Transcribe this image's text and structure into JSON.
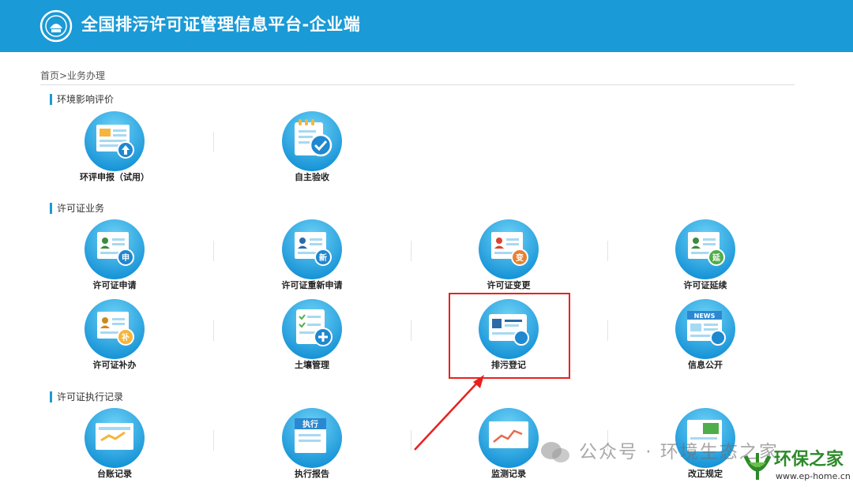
{
  "header": {
    "title": "全国排污许可证管理信息平台-企业端",
    "logo_icon": "emblem-icon",
    "bg_color": "#1a9ad6"
  },
  "breadcrumb": "首页>业务办理",
  "sections": [
    {
      "title": "环境影响评价",
      "items": [
        {
          "label": "环评申报（试用）",
          "icon": "document-upload-icon"
        },
        {
          "label": "自主验收",
          "icon": "clipboard-check-icon"
        }
      ]
    },
    {
      "title": "许可证业务",
      "items": [
        {
          "label": "许可证申请",
          "icon": "license-apply-icon",
          "badge": "申"
        },
        {
          "label": "许可证重新申请",
          "icon": "license-reapply-icon",
          "badge": "新"
        },
        {
          "label": "许可证变更",
          "icon": "license-change-icon",
          "badge": "变"
        },
        {
          "label": "许可证延续",
          "icon": "license-extend-icon",
          "badge": "延"
        },
        {
          "label": "许可证补办",
          "icon": "license-reissue-icon",
          "badge": "补"
        },
        {
          "label": "土壤管理",
          "icon": "soil-checklist-icon"
        },
        {
          "label": "排污登记",
          "icon": "registration-card-icon"
        },
        {
          "label": "信息公开",
          "icon": "news-icon",
          "badge": "NEWS"
        }
      ]
    },
    {
      "title": "许可证执行记录",
      "items": [
        {
          "label": "台账记录",
          "icon": "ledger-icon"
        },
        {
          "label": "执行报告",
          "icon": "execution-report-icon",
          "badge": "执行"
        },
        {
          "label": "监测记录",
          "icon": "monitoring-chart-icon"
        },
        {
          "label": "改正规定",
          "icon": "correction-icon"
        }
      ]
    }
  ],
  "highlight_color": "#e8211d",
  "watermark": {
    "text": "公众号 · 环境生态之家",
    "brand_name": "环保之家",
    "brand_url": "www.ep-home.cn"
  }
}
